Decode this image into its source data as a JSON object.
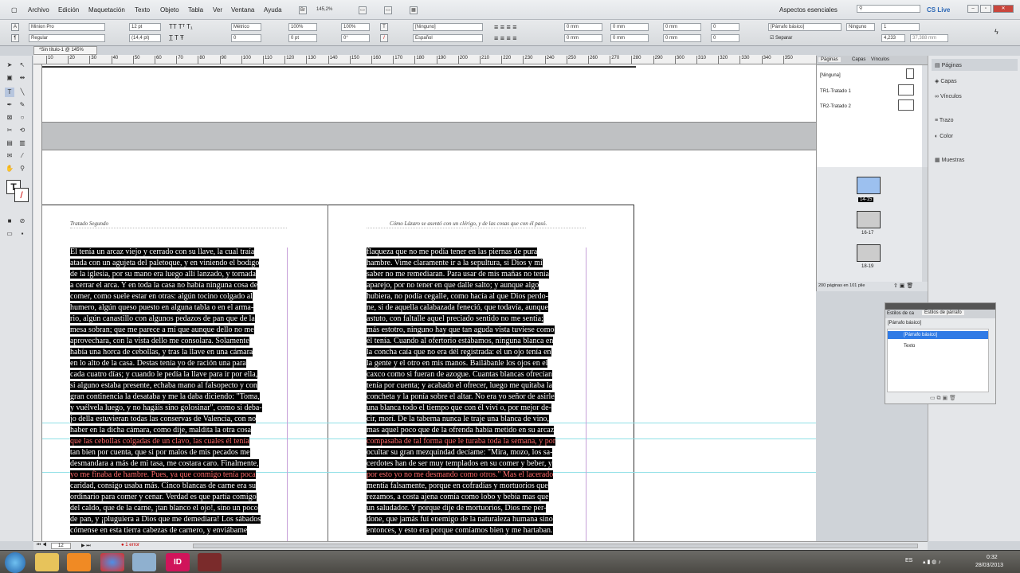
{
  "menubar": {
    "items": [
      "Archivo",
      "Edición",
      "Maquetación",
      "Texto",
      "Objeto",
      "Tabla",
      "Ver",
      "Ventana",
      "Ayuda"
    ],
    "zoom": "145,2%",
    "workspace": "Aspectos esenciales",
    "cs_live": "CS Live"
  },
  "control_panel": {
    "font_family": "Minion Pro",
    "font_style": "Regular",
    "font_size": "12 pt",
    "leading": "(14,4 pt)",
    "kerning": "Métrico",
    "tracking": "0",
    "vertical_scale": "100%",
    "horizontal_scale": "100%",
    "baseline_shift": "0 pt",
    "skew": "0°",
    "char_style": "[Ninguno]",
    "language": "Español",
    "indent_left": "0 mm",
    "indent_right": "0 mm",
    "first_line": "0 mm",
    "last_line": "0 mm",
    "space_before": "0 mm",
    "space_after": "0 mm",
    "drop_lines": "0",
    "drop_chars": "0",
    "para_style": "[Párrafo básico]",
    "para_style2": "Ninguno",
    "columns": "1",
    "gutter": "4,233",
    "separar": "Separar",
    "col_width": "37,388 mm"
  },
  "doc_tab": "*Sin título-1 @ 145%",
  "ruler_h_labels": [
    "10",
    "20",
    "30",
    "40",
    "50",
    "60",
    "70",
    "80",
    "90",
    "100",
    "110",
    "120",
    "130",
    "140",
    "150",
    "160",
    "170",
    "180",
    "190",
    "200",
    "210",
    "220",
    "230",
    "240",
    "250",
    "260",
    "270",
    "280",
    "290",
    "300",
    "310",
    "320",
    "330",
    "340",
    "350"
  ],
  "pages": {
    "left_header": "Tratado Segundo",
    "right_header": "Cómo Lázaro se asentó con un clérigo, y de las cosas que con él pasó.",
    "left_lines": [
      "El tenía un arcaz viejo y cerrado con su llave, la cual traía",
      "atada con un agujeta del paletoque, y en viniendo el bodigo",
      "de la iglesia, por su mano era luego allí lanzado, y tornada",
      "a cerrar el arca. Y en toda la casa no había ninguna cosa de",
      "comer, como suele estar en otras: algún tocino colgado al",
      "humero, algún queso puesto en alguna tabla o en el arma-",
      "rio, algún canastillo con algunos pedazos de pan que de la",
      "mesa sobran; que me parece a mí que aunque dello no me",
      "aprovechara, con la vista dello me consolara. Solamente",
      "había una horca de cebollas, y tras la llave en una cámara",
      "en lo alto de la casa. Destas tenía yo de ración una para",
      "cada cuatro días; y cuando le pedía la llave para ir por ella,",
      "si alguno estaba presente, echaba mano al falsopecto y con",
      "gran continencia la desataba y me la daba diciendo: \"Toma,",
      "y vuélvela luego, y no hagáis sino golosinar\", como si deba-",
      "jo della estuvieran todas las conservas de Valencia, con no",
      "haber en la dicha cámara, como dije, maldita la otra cosa",
      "que las cebollas colgadas de un clavo, las cuales él tenía",
      "tan bien por cuenta, que si por malos de mis pecados me",
      "desmandara a más de mi tasa, me costara caro. Finalmente,",
      "yo me finaba de hambre. Pues, ya que conmigo tenía poca",
      "caridad, consigo usaba más. Cinco blancas de carne era su",
      "ordinario para comer y cenar. Verdad es que partía comigo",
      "del caldo, que de la carne, ¡tan blanco el ojo!, sino un poco",
      "de pan, y ¡pluguiera a Dios que me demediara! Los sábados",
      "cómense en esta tierra cabezas de carnero, y enviábame"
    ],
    "right_lines": [
      "flaqueza que no me podía tener en las piernas de pura",
      "hambre. Vime claramente ir a la sepultura, si Dios y mi",
      "saber no me remediaran. Para usar de mis mañas no tenía",
      "aparejo, por no tener en que dalle salto; y aunque algo",
      "hubiera, no podía cegalle, como hacía al que Dios perdo-",
      "ne, si de aquella calabazada feneció, que todavía, aunque",
      "astuto, con faltalle aquel preciado sentido no me sentía;",
      "más estotro, ninguno hay que tan aguda vista tuviese como",
      "él tenía. Cuando al ofertorio estábamos, ninguna blanca en",
      "la concha caía que no era dél registrada: el un ojo tenía en",
      "la gente y el otro en mis manos. Bailábanle los ojos en el",
      "caxco como si fueran de azogue. Cuantas blancas ofrecían",
      "tenía por cuenta; y acabado el ofrecer, luego me quitaba la",
      "concheta y la ponía sobre el altar. No era yo señor de asirle",
      "una blanca todo el tiempo que con él viví o, por mejor de-",
      "cir, morí. De la taberna nunca le traje una blanca de vino,",
      "mas aquel poco que de la ofrenda había metido en su arcaz",
      "compasaba de tal forma que le turaba toda la semana, y por",
      "ocultar su gran mezquindad decíame: \"Mira, mozo, los sa-",
      "cerdotes han de ser muy templados en su comer y beber, y",
      "por esto yo no me desmando como otros.\" Mas el lacerado",
      "mentía falsamente, porque en cofradías y mortuorios que",
      "rezamos, a costa ajena comía como lobo y bebía mas que",
      "un saludador. Y porque dije de mortuorios, Dios me per-",
      "done, que jamás fuí enemigo de la naturaleza humana sino",
      "entonces, y esto era porque comíamos bien y me hartaban."
    ],
    "left_red_lines": [
      17,
      20
    ],
    "right_red_lines": [
      17,
      20
    ]
  },
  "pages_panel": {
    "tabs": [
      "Páginas",
      "Capas",
      "Vínculos"
    ],
    "masters": [
      "[Ninguna]",
      "TR1-Tratado 1",
      "TR2-Tratado 2"
    ],
    "spreads": [
      "14-15",
      "16-17",
      "18-19"
    ],
    "footer": "200 páginas en 101 plie"
  },
  "side_panels": [
    "Páginas",
    "Capas",
    "Vínculos",
    "Trazo",
    "Color",
    "Muestras"
  ],
  "para_styles_panel": {
    "tabs": [
      "Estilos de ca",
      "Estilos de párrafo"
    ],
    "current": "[Párrafo básico]",
    "items": [
      "[Párrafo básico]",
      "Texto"
    ]
  },
  "status": {
    "page": "12",
    "errors": "1 error"
  },
  "taskbar": {
    "lang": "ES",
    "time": "0:32",
    "date": "28/03/2013"
  },
  "colors": {
    "highlight": "#000000",
    "red_text": "#ff6a6a",
    "selection_blue": "#2f7ae5",
    "taskbar_indesign": "#d0145a"
  }
}
